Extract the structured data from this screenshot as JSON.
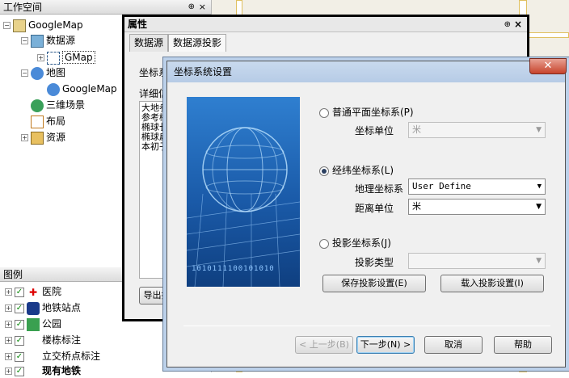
{
  "workspace": {
    "title": "工作空间",
    "pin": "⊕",
    "close": "×",
    "root": "GoogleMap",
    "datasources": "数据源",
    "gmap": "GMap",
    "maps": "地图",
    "googlemap": "GoogleMap",
    "scenes": "三维场景",
    "layouts": "布局",
    "resources": "资源"
  },
  "legend": {
    "title": "图例",
    "items": [
      "医院",
      "地铁站点",
      "公园",
      "楼栋标注",
      "立交桥点标注",
      "现有地铁"
    ]
  },
  "property": {
    "title": "属性",
    "pin": "⊕",
    "close": "×",
    "tab_datasource": "数据源",
    "tab_projection": "数据源投影",
    "coord_label": "坐标系",
    "detail_label": "详细信",
    "detail_lines": [
      "大地参",
      "参考椭",
      "椭球长",
      "椭球扁",
      "本初子"
    ],
    "export_button": "导出投"
  },
  "dialog": {
    "title": "坐标系统设置",
    "close": "✕",
    "plane_label": "普通平面坐标系(P)",
    "coord_unit_label": "坐标单位",
    "coord_unit_value": "米",
    "geo_label": "经纬坐标系(L)",
    "geo_coord_label": "地理坐标系",
    "geo_coord_value": "User Define",
    "dist_unit_label": "距离单位",
    "dist_unit_value": "米",
    "proj_label": "投影坐标系(J)",
    "proj_type_label": "投影类型",
    "proj_type_value": "",
    "save_button": "保存投影设置(E)",
    "load_button": "载入投影设置(I)",
    "prev_button": "< 上一步(B)",
    "next_button": "下一步(N) >",
    "cancel_button": "取消",
    "help_button": "帮助",
    "binary_text": "1010111100101010"
  }
}
